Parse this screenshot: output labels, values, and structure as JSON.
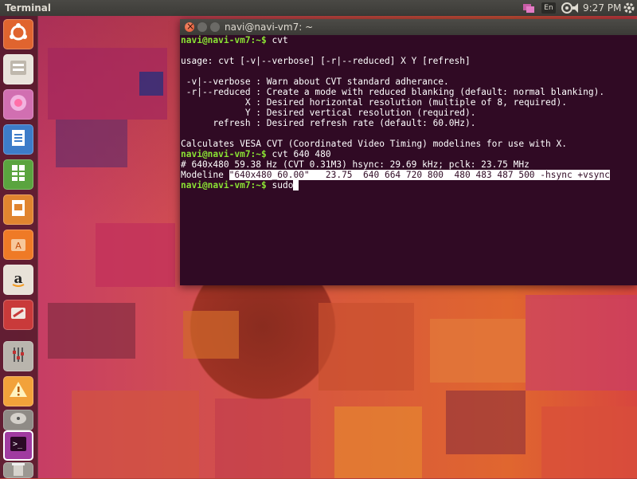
{
  "top_panel": {
    "app_title": "Terminal",
    "keyboard_layout": "En",
    "clock": "9:27 PM",
    "icons": [
      "messaging-icon",
      "keyboard-layout-icon",
      "network-icon",
      "volume-icon",
      "clock",
      "settings-gear-icon"
    ]
  },
  "launcher": {
    "items": [
      {
        "name": "dash-home",
        "icon": "ubuntu-logo-icon",
        "color": "#e0642f"
      },
      {
        "name": "files",
        "icon": "file-cabinet-icon",
        "color": "#e9e4dc"
      },
      {
        "name": "firefox",
        "icon": "browser-icon",
        "color": "#d16fb1"
      },
      {
        "name": "writer",
        "icon": "document-icon",
        "color": "#3d7cc9"
      },
      {
        "name": "calc",
        "icon": "spreadsheet-icon",
        "color": "#5aa43f"
      },
      {
        "name": "impress",
        "icon": "presentation-icon",
        "color": "#e0842f"
      },
      {
        "name": "software-center",
        "icon": "shopping-bag-icon",
        "color": "#ef7a26"
      },
      {
        "name": "amazon",
        "icon": "amazon-icon",
        "color": "#e8e2d8"
      },
      {
        "name": "ubuntu-one",
        "icon": "ubuntu-one-icon",
        "color": "#c93a3a"
      },
      {
        "name": "system-settings",
        "icon": "sliders-icon",
        "color": "#b9b5ad"
      },
      {
        "name": "update-manager",
        "icon": "warning-icon",
        "color": "#f2a23a"
      },
      {
        "name": "disks",
        "icon": "disk-icon",
        "color": "#8f8b86"
      },
      {
        "name": "terminal",
        "icon": "terminal-icon",
        "color": "#a03ba0"
      },
      {
        "name": "trash",
        "icon": "trash-icon",
        "color": "#9c9892"
      }
    ]
  },
  "terminal": {
    "title": "navi@navi-vm7: ~",
    "lines": [
      {
        "prompt": "navi@navi-vm7:~$",
        "text": " cvt"
      },
      {
        "text": ""
      },
      {
        "text": "usage: cvt [-v|--verbose] [-r|--reduced] X Y [refresh]"
      },
      {
        "text": ""
      },
      {
        "text": " -v|--verbose : Warn about CVT standard adherance."
      },
      {
        "text": " -r|--reduced : Create a mode with reduced blanking (default: normal blanking)."
      },
      {
        "text": "            X : Desired horizontal resolution (multiple of 8, required)."
      },
      {
        "text": "            Y : Desired vertical resolution (required)."
      },
      {
        "text": "      refresh : Desired refresh rate (default: 60.0Hz)."
      },
      {
        "text": ""
      },
      {
        "text": "Calculates VESA CVT (Coordinated Video Timing) modelines for use with X."
      },
      {
        "prompt": "navi@navi-vm7:~$",
        "text": " cvt 640 480"
      },
      {
        "text": "# 640x480 59.38 Hz (CVT 0.31M3) hsync: 29.69 kHz; pclk: 23.75 MHz"
      },
      {
        "text": "Modeline ",
        "highlight": "\"640x480_60.00\"   23.75  640 664 720 800  480 483 487 500 -hsync +vsync"
      },
      {
        "prompt": "navi@navi-vm7:~$",
        "text": " sudo",
        "cursor": true
      }
    ]
  }
}
